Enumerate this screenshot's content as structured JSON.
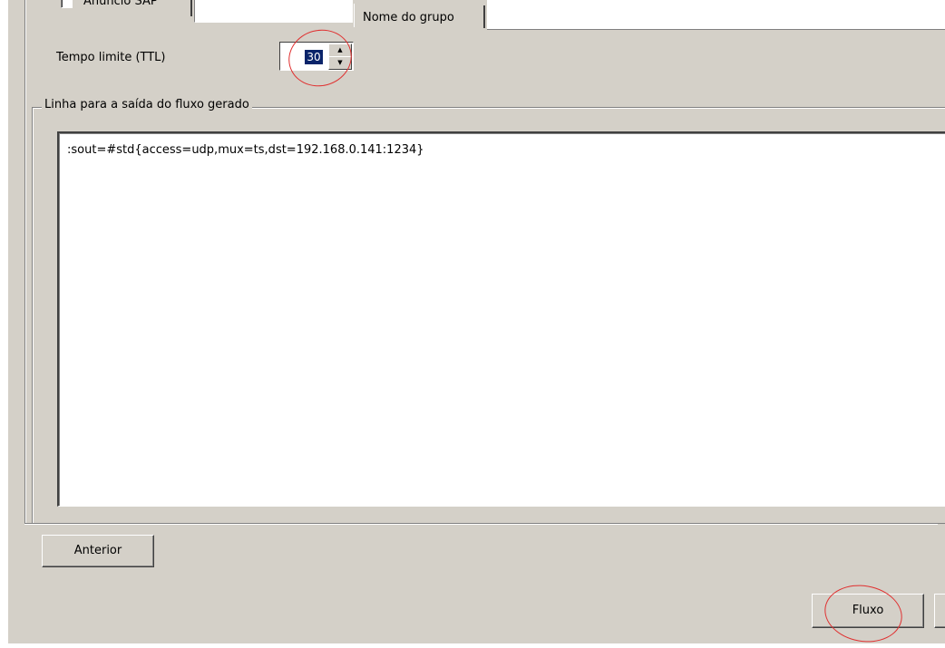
{
  "sap": {
    "label": "Anúncio SAP"
  },
  "group": {
    "label": "Nome do grupo"
  },
  "ttl": {
    "label": "Tempo limite (TTL)",
    "value": "30"
  },
  "output": {
    "legend": "Linha para a saída do fluxo gerado",
    "text": ":sout=#std{access=udp,mux=ts,dst=192.168.0.141:1234}"
  },
  "buttons": {
    "back": "Anterior",
    "stream": "Fluxo"
  },
  "colors": {
    "dialog_bg": "#d4d0c8",
    "selection": "#0a246a",
    "annotation": "#e03030"
  }
}
